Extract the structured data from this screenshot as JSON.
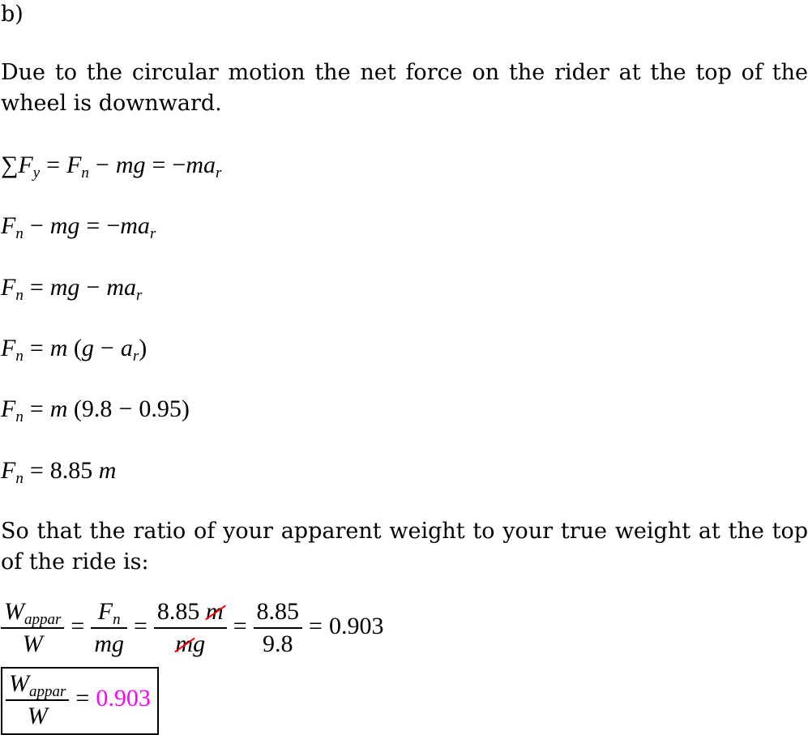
{
  "part_label": "b)",
  "intro": {
    "line1": "Due to the circular motion the net force on the rider at the top of the",
    "line2": "wheel is downward."
  },
  "equations": {
    "eq1": {
      "sum": "∑",
      "F": "F",
      "y": "y",
      "eq": "=",
      "Fn": "F",
      "n": "n",
      "minus": "−",
      "mg": "mg",
      "eq2": "=",
      "neg": "−",
      "ma": "ma",
      "r": "r"
    },
    "eq2": {
      "Fn": "F",
      "n": "n",
      "minus": "−",
      "mg": "mg",
      "eq": "=",
      "neg": "−",
      "ma": "ma",
      "r": "r"
    },
    "eq3": {
      "Fn": "F",
      "n": "n",
      "eq": "=",
      "mg": "mg",
      "minus": "−",
      "ma": "ma",
      "r": "r"
    },
    "eq4": {
      "Fn": "F",
      "n": "n",
      "eq": "=",
      "m": "m",
      "open": "(",
      "g": "g",
      "minus": "−",
      "a": "a",
      "r": "r",
      "close": ")"
    },
    "eq5": {
      "Fn": "F",
      "n": "n",
      "eq": "=",
      "m": "m",
      "open": "(",
      "v1": "9.8",
      "minus": "−",
      "v2": "0.95",
      "close": ")"
    },
    "eq6": {
      "Fn": "F",
      "n": "n",
      "eq": "=",
      "val": "8.85",
      "m": "m"
    }
  },
  "conclusion": {
    "line1": "So that the ratio of your apparent weight to your true weight at the top",
    "line2": "of the ride is:"
  },
  "ratio": {
    "W": "W",
    "appar": "appar",
    "eq": "=",
    "Fn": "F",
    "n": "n",
    "mg": "mg",
    "num_val": "8.85",
    "m_cancel": "m",
    "den_m_cancel": "m",
    "den_g": "g",
    "frac4_num": "8.85",
    "frac4_den": "9.8",
    "result": "0.903"
  },
  "answer": {
    "W": "W",
    "appar": "appar",
    "eq": "=",
    "value": "0.903",
    "value_color": "#ff00ff"
  }
}
